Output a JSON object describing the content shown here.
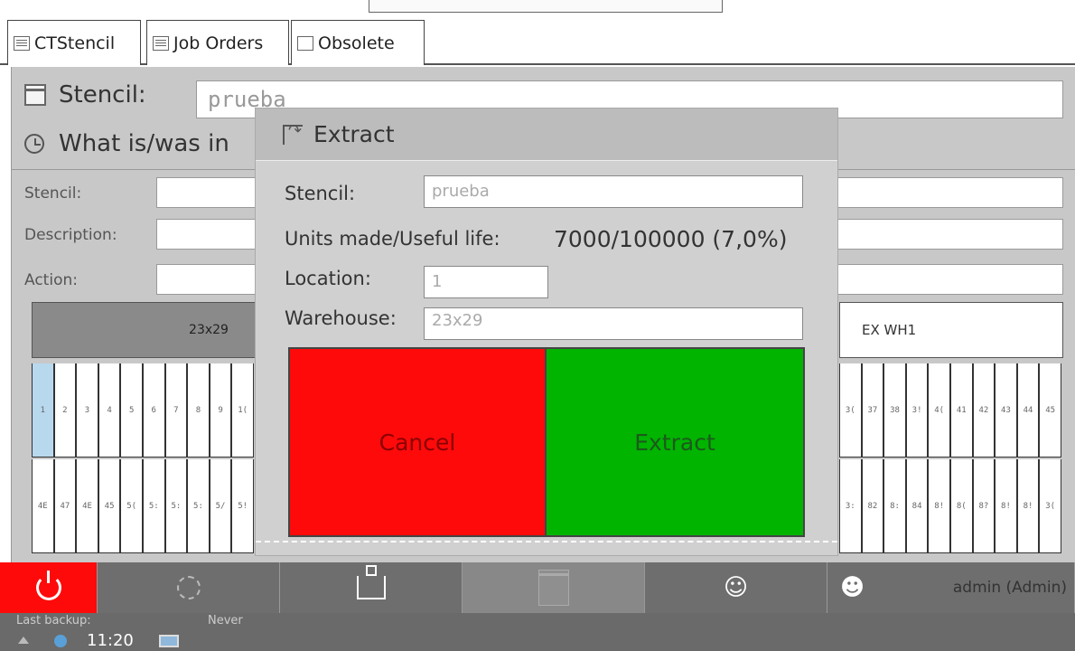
{
  "tabs": [
    {
      "label": "CTStencil",
      "icon": "stencil-list-icon"
    },
    {
      "label": "Job Orders",
      "icon": "job-orders-icon"
    },
    {
      "label": "Obsolete",
      "icon": "obsolete-icon"
    }
  ],
  "main": {
    "stencil_label": "Stencil:",
    "stencil_value": "prueba",
    "what_label": "What is/was in",
    "fields": {
      "stencil": "Stencil:",
      "description": "Description:",
      "action": "Action:"
    },
    "warehouse_left": "23x29",
    "warehouse_right": "EX WH1",
    "slots_top_left": [
      "1",
      "2",
      "3",
      "4",
      "5",
      "6",
      "7",
      "8",
      "9",
      "1("
    ],
    "slots_top_right": [
      "3(",
      "37",
      "38",
      "3!",
      "4(",
      "41",
      "42",
      "43",
      "44",
      "45"
    ],
    "slots_bottom_left": [
      "4E",
      "47",
      "4E",
      "45",
      "5(",
      "5:",
      "5:",
      "5:",
      "5/",
      "5!"
    ],
    "slots_bottom_right": [
      "3:",
      "82",
      "8:",
      "84",
      "8!",
      "8(",
      "8?",
      "8!",
      "8!",
      "3("
    ]
  },
  "modal": {
    "title": "Extract",
    "stencil_label": "Stencil:",
    "stencil_value": "prueba",
    "units_label": "Units made/Useful life:",
    "units_value": "7000/100000 (7,0%)",
    "location_label": "Location:",
    "location_value": "1",
    "warehouse_label": "Warehouse:",
    "warehouse_value": "23x29",
    "cancel_label": "Cancel",
    "extract_label": "Extract"
  },
  "bottom": {
    "user_label": "admin (Admin)"
  },
  "status": {
    "backup_label": "Last backup:",
    "backup_value": "Never",
    "time": "11:20"
  },
  "colors": {
    "cancel": "#ff0a0a",
    "extract": "#00b400",
    "power": "#ff0a0a",
    "panel": "#c8c8c8"
  }
}
